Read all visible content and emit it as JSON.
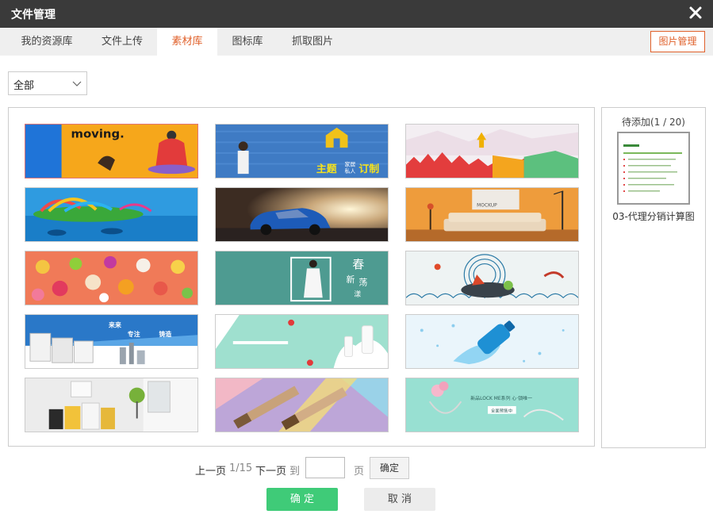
{
  "window": {
    "title": "文件管理",
    "close_icon": "close-icon"
  },
  "tabs": [
    {
      "label": "我的资源库",
      "active": false
    },
    {
      "label": "文件上传",
      "active": false
    },
    {
      "label": "素材库",
      "active": true
    },
    {
      "label": "图标库",
      "active": false
    },
    {
      "label": "抓取图片",
      "active": false
    }
  ],
  "header_button": "图片管理",
  "filter": {
    "selected": "全部"
  },
  "thumbnails": [
    {
      "name": "moving-banner",
      "text": "moving.",
      "selected": true
    },
    {
      "name": "custom-home-banner",
      "text1": "家居",
      "text2": "私人",
      "text3": "主题",
      "text4": "订制",
      "selected": false
    },
    {
      "name": "celebration-banner",
      "selected": false
    },
    {
      "name": "waterpark-banner",
      "selected": false
    },
    {
      "name": "car-banner",
      "selected": false
    },
    {
      "name": "living-room-banner",
      "text": "MOCKUP",
      "selected": false
    },
    {
      "name": "food-banner",
      "selected": false
    },
    {
      "name": "spring-fashion-banner",
      "text1": "春",
      "text2": "新",
      "text3": "荡",
      "text4": "漾",
      "selected": false
    },
    {
      "name": "seafood-banner",
      "selected": false
    },
    {
      "name": "building-banner",
      "text1": "来来",
      "text2": "专注",
      "text3": "铸造",
      "selected": false
    },
    {
      "name": "milk-banner",
      "selected": false
    },
    {
      "name": "water-bottle-banner",
      "selected": false
    },
    {
      "name": "paint-banner",
      "selected": false
    },
    {
      "name": "brushes-banner",
      "selected": false
    },
    {
      "name": "jewelry-banner",
      "text1": "新品LOCK ME系列 心·锁唯一",
      "text2": "全面预售中",
      "selected": false
    }
  ],
  "pending": {
    "title": "待添加(1 / 20)",
    "item_name": "03-代理分销计算图"
  },
  "pagination": {
    "prev": "上一页",
    "page": "1/15",
    "next": "下一页",
    "goto": "到",
    "unit": "页",
    "go_button": "确定",
    "input_value": ""
  },
  "footer": {
    "ok": "确 定",
    "cancel": "取 消"
  },
  "colors": {
    "accent": "#e0612b",
    "ok_green": "#3fcb78",
    "titlebar": "#3a3a3a"
  }
}
